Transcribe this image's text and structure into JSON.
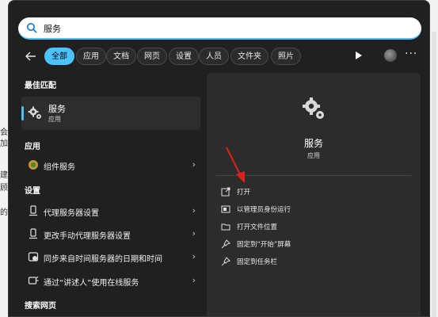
{
  "search": {
    "value": "服务",
    "placeholder": ""
  },
  "filters": {
    "chips": [
      "全部",
      "应用",
      "文档",
      "网页",
      "设置",
      "人员",
      "文件夹",
      "照片"
    ],
    "active_index": 0
  },
  "sections": {
    "best_match": "最佳匹配",
    "apps": "应用",
    "settings": "设置",
    "web": "搜索网页"
  },
  "best_match": {
    "title": "服务",
    "subtitle": "应用"
  },
  "apps": [
    {
      "label": "组件服务"
    }
  ],
  "settings": [
    {
      "label": "代理服务器设置"
    },
    {
      "label": "更改手动代理服务器设置"
    },
    {
      "label": "同步来自时间服务器的日期和时间"
    },
    {
      "label": "通过“讲述人”使用在线服务"
    }
  ],
  "detail": {
    "title": "服务",
    "subtitle": "应用",
    "actions": [
      "打开",
      "以管理员身份运行",
      "打开文件位置",
      "固定到“开始”屏幕",
      "固定到任务栏"
    ]
  },
  "background_fragments": [
    "会",
    "加",
    "建",
    "顾",
    "的"
  ],
  "colors": {
    "accent": "#4cc2ff",
    "panel": "#202020",
    "pane": "#2c2c2c",
    "annotation_arrow": "#e02020"
  }
}
